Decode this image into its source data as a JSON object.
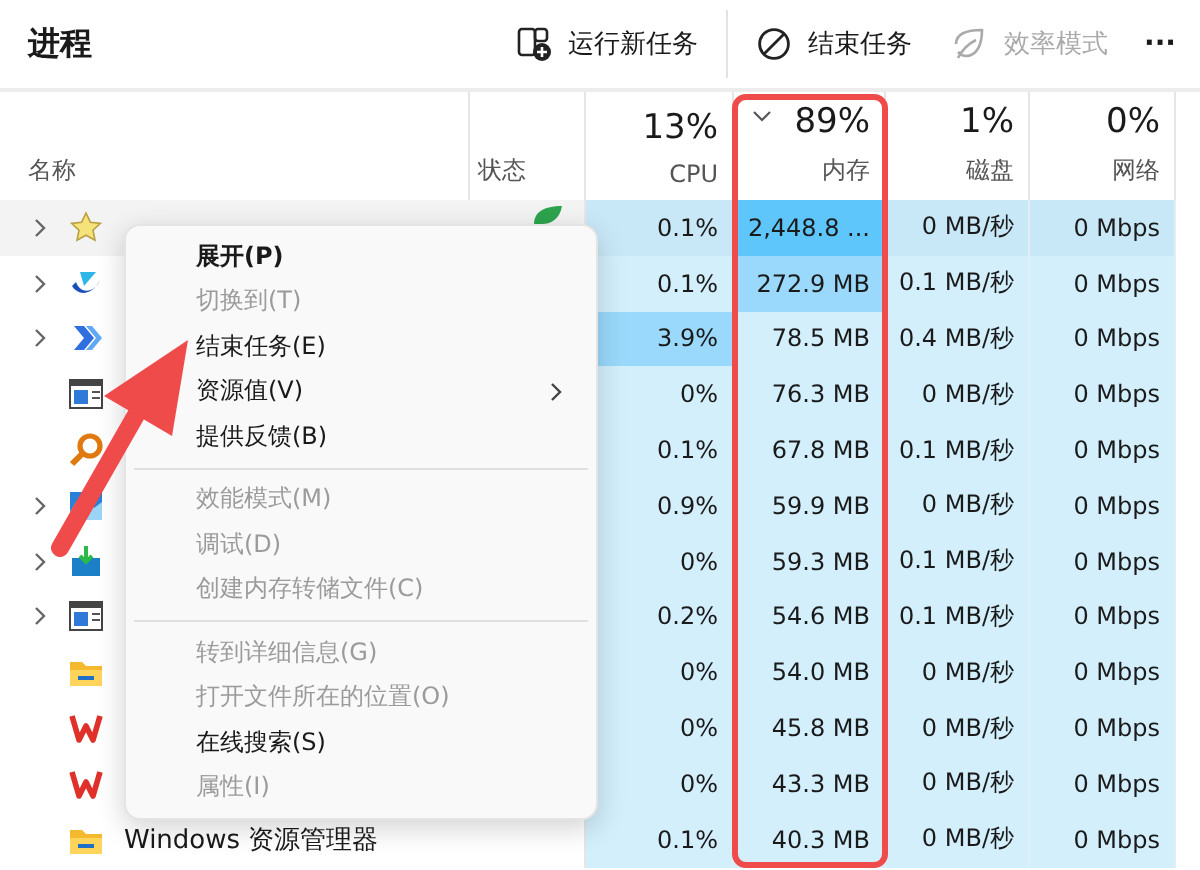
{
  "header": {
    "title": "进程",
    "actions": [
      {
        "kind": "run",
        "label": "运行新任务",
        "disabled": false
      },
      {
        "kind": "end",
        "label": "结束任务",
        "disabled": false
      },
      {
        "kind": "eco",
        "label": "效率模式",
        "disabled": true
      },
      {
        "kind": "more",
        "label": "···",
        "disabled": false
      }
    ]
  },
  "columns": [
    {
      "label": "名称"
    },
    {
      "label": "状态"
    },
    {
      "percent": "13%",
      "label": "CPU",
      "sorted": false
    },
    {
      "percent": "89%",
      "label": "内存",
      "sorted": true
    },
    {
      "percent": "1%",
      "label": "磁盘",
      "sorted": false
    },
    {
      "percent": "0%",
      "label": "网络",
      "sorted": false
    }
  ],
  "rows": [
    {
      "kind": "star",
      "expandable": true,
      "hovered": true,
      "efficiency": true,
      "cells": [
        {
          "text": "0.1%",
          "kind": "light"
        },
        {
          "text": "2,448.8 ...",
          "kind": "strong"
        },
        {
          "text": "0 MB/秒",
          "kind": "light"
        },
        {
          "text": "0 Mbps",
          "kind": "light"
        }
      ]
    },
    {
      "kind": "swoosh",
      "expandable": true,
      "hovered": false,
      "efficiency": false,
      "cells": [
        {
          "text": "0.1%",
          "kind": "light"
        },
        {
          "text": "272.9 MB",
          "kind": "medium"
        },
        {
          "text": "0.1 MB/秒",
          "kind": "light"
        },
        {
          "text": "0 Mbps",
          "kind": "light"
        }
      ]
    },
    {
      "kind": "chevrons",
      "expandable": true,
      "hovered": false,
      "efficiency": false,
      "cells": [
        {
          "text": "3.9%",
          "kind": "medium"
        },
        {
          "text": "78.5 MB",
          "kind": "light"
        },
        {
          "text": "0.4 MB/秒",
          "kind": "light"
        },
        {
          "text": "0 Mbps",
          "kind": "light"
        }
      ]
    },
    {
      "kind": "window",
      "expandable": false,
      "hovered": false,
      "efficiency": false,
      "cells": [
        {
          "text": "0%",
          "kind": "light"
        },
        {
          "text": "76.3 MB",
          "kind": "light"
        },
        {
          "text": "0 MB/秒",
          "kind": "light"
        },
        {
          "text": "0 Mbps",
          "kind": "light"
        }
      ]
    },
    {
      "kind": "magnifier",
      "expandable": false,
      "hovered": false,
      "efficiency": false,
      "cells": [
        {
          "text": "0.1%",
          "kind": "light"
        },
        {
          "text": "67.8 MB",
          "kind": "light"
        },
        {
          "text": "0.1 MB/秒",
          "kind": "light"
        },
        {
          "text": "0 Mbps",
          "kind": "light"
        }
      ]
    },
    {
      "kind": "chart",
      "expandable": true,
      "hovered": false,
      "efficiency": false,
      "cells": [
        {
          "text": "0.9%",
          "kind": "light"
        },
        {
          "text": "59.9 MB",
          "kind": "light"
        },
        {
          "text": "0 MB/秒",
          "kind": "light"
        },
        {
          "text": "0 Mbps",
          "kind": "light"
        }
      ]
    },
    {
      "kind": "download",
      "expandable": true,
      "hovered": false,
      "efficiency": false,
      "cells": [
        {
          "text": "0%",
          "kind": "light"
        },
        {
          "text": "59.3 MB",
          "kind": "light"
        },
        {
          "text": "0.1 MB/秒",
          "kind": "light"
        },
        {
          "text": "0 Mbps",
          "kind": "light"
        }
      ]
    },
    {
      "kind": "window",
      "expandable": true,
      "hovered": false,
      "efficiency": false,
      "cells": [
        {
          "text": "0.2%",
          "kind": "light"
        },
        {
          "text": "54.6 MB",
          "kind": "light"
        },
        {
          "text": "0.1 MB/秒",
          "kind": "light"
        },
        {
          "text": "0 Mbps",
          "kind": "light"
        }
      ]
    },
    {
      "kind": "folder",
      "expandable": false,
      "hovered": false,
      "efficiency": false,
      "cells": [
        {
          "text": "0%",
          "kind": "light"
        },
        {
          "text": "54.0 MB",
          "kind": "light"
        },
        {
          "text": "0 MB/秒",
          "kind": "light"
        },
        {
          "text": "0 Mbps",
          "kind": "light"
        }
      ]
    },
    {
      "kind": "wps",
      "expandable": false,
      "hovered": false,
      "efficiency": false,
      "cells": [
        {
          "text": "0%",
          "kind": "light"
        },
        {
          "text": "45.8 MB",
          "kind": "light"
        },
        {
          "text": "0 MB/秒",
          "kind": "light"
        },
        {
          "text": "0 Mbps",
          "kind": "light"
        }
      ]
    },
    {
      "kind": "wps",
      "expandable": false,
      "hovered": false,
      "efficiency": false,
      "cells": [
        {
          "text": "0%",
          "kind": "light"
        },
        {
          "text": "43.3 MB",
          "kind": "light"
        },
        {
          "text": "0 MB/秒",
          "kind": "light"
        },
        {
          "text": "0 Mbps",
          "kind": "light"
        }
      ]
    },
    {
      "kind": "folder",
      "name": "Windows 资源管理器",
      "expandable": false,
      "hovered": false,
      "efficiency": false,
      "cells": [
        {
          "text": "0.1%",
          "kind": "light"
        },
        {
          "text": "40.3 MB",
          "kind": "light"
        },
        {
          "text": "0 MB/秒",
          "kind": "light"
        },
        {
          "text": "0 Mbps",
          "kind": "light"
        }
      ]
    }
  ],
  "context_menu": {
    "items": [
      {
        "kind": "item",
        "label": "展开(P)",
        "bold": true,
        "disabled": false,
        "submenu": false
      },
      {
        "kind": "item",
        "label": "切换到(T)",
        "bold": false,
        "disabled": true,
        "submenu": false
      },
      {
        "kind": "item",
        "label": "结束任务(E)",
        "bold": false,
        "disabled": false,
        "submenu": false
      },
      {
        "kind": "item",
        "label": "资源值(V)",
        "bold": false,
        "disabled": false,
        "submenu": true
      },
      {
        "kind": "item",
        "label": "提供反馈(B)",
        "bold": false,
        "disabled": false,
        "submenu": false
      },
      {
        "kind": "separator"
      },
      {
        "kind": "item",
        "label": "效能模式(M)",
        "bold": false,
        "disabled": true,
        "submenu": false
      },
      {
        "kind": "item",
        "label": "调试(D)",
        "bold": false,
        "disabled": true,
        "submenu": false
      },
      {
        "kind": "item",
        "label": "创建内存转储文件(C)",
        "bold": false,
        "disabled": true,
        "submenu": false
      },
      {
        "kind": "separator"
      },
      {
        "kind": "item",
        "label": "转到详细信息(G)",
        "bold": false,
        "disabled": true,
        "submenu": false
      },
      {
        "kind": "item",
        "label": "打开文件所在的位置(O)",
        "bold": false,
        "disabled": true,
        "submenu": false
      },
      {
        "kind": "item",
        "label": "在线搜索(S)",
        "bold": false,
        "disabled": false,
        "submenu": false
      },
      {
        "kind": "item",
        "label": "属性(I)",
        "bold": false,
        "disabled": true,
        "submenu": false
      }
    ]
  },
  "highlight_frame": {
    "color": "#ef4b4b"
  },
  "pointer_arrow": {
    "color": "#ef4b4b"
  }
}
